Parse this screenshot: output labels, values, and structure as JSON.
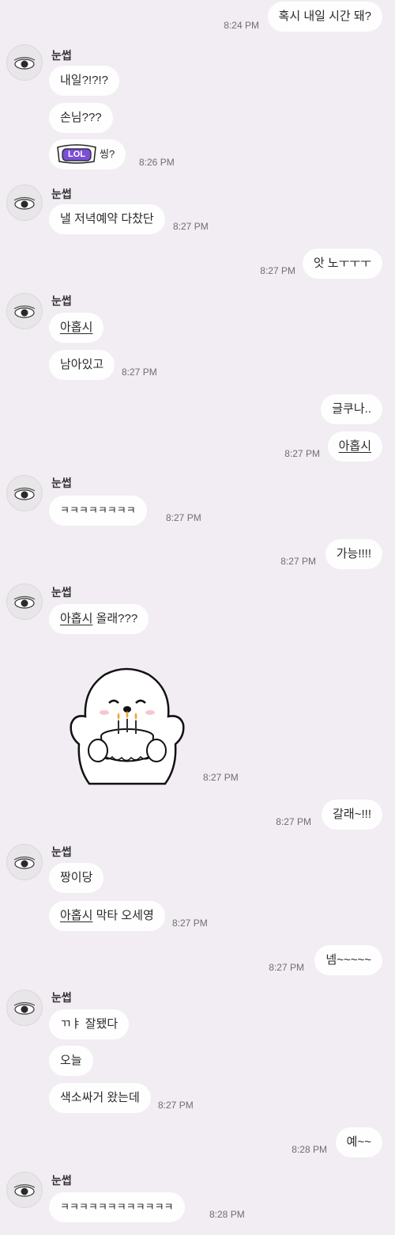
{
  "contact": {
    "name": "눈썹"
  },
  "messages": {
    "m1": {
      "text": "혹시 내일 시간 돼?",
      "time": "8:24 PM"
    },
    "m2": {
      "text": "내일?!?!?"
    },
    "m3": {
      "text": "손님???"
    },
    "m4": {
      "sticker": "LOL",
      "text": "씽?",
      "time": "8:26 PM"
    },
    "m5": {
      "text": "낼 저녁예약 다찼단",
      "time": "8:27 PM"
    },
    "m6": {
      "text": "앗 노ㅜㅜㅜ",
      "time": "8:27 PM"
    },
    "m7": {
      "text": "아홉시"
    },
    "m8": {
      "text": "남아있고",
      "time": "8:27 PM"
    },
    "m9": {
      "text": "글쿠나.."
    },
    "m10": {
      "text": "아홉시",
      "time": "8:27 PM"
    },
    "m11": {
      "text": "ㅋㅋㅋㅋㅋㅋㅋㅋ",
      "time": "8:27 PM"
    },
    "m12": {
      "text": "가능!!!!",
      "time": "8:27 PM"
    },
    "m13": {
      "link": "아홉시",
      "text": " 올래???"
    },
    "m14": {
      "sticker": "birthday-cake-character",
      "time": "8:27 PM"
    },
    "m15": {
      "text": "갈래~!!!",
      "time": "8:27 PM"
    },
    "m16": {
      "text": "짱이당"
    },
    "m17": {
      "link": "아홉시",
      "text": " 막타 오세영",
      "time": "8:27 PM"
    },
    "m18": {
      "text": "넴~~~~~",
      "time": "8:27 PM"
    },
    "m19": {
      "text": "ㄲㅑ 잘됐다"
    },
    "m20": {
      "text": "오늘"
    },
    "m21": {
      "text": "색소싸거 왔는데",
      "time": "8:27 PM"
    },
    "m22": {
      "text": "예~~",
      "time": "8:28 PM"
    },
    "m23": {
      "text": "ㅋㅋㅋㅋㅋㅋㅋㅋㅋㅋㅋㅋ",
      "time": "8:28 PM"
    }
  },
  "colors": {
    "background": "#f1edf3",
    "bubble": "#fefefe",
    "time": "#6f6f6f"
  }
}
